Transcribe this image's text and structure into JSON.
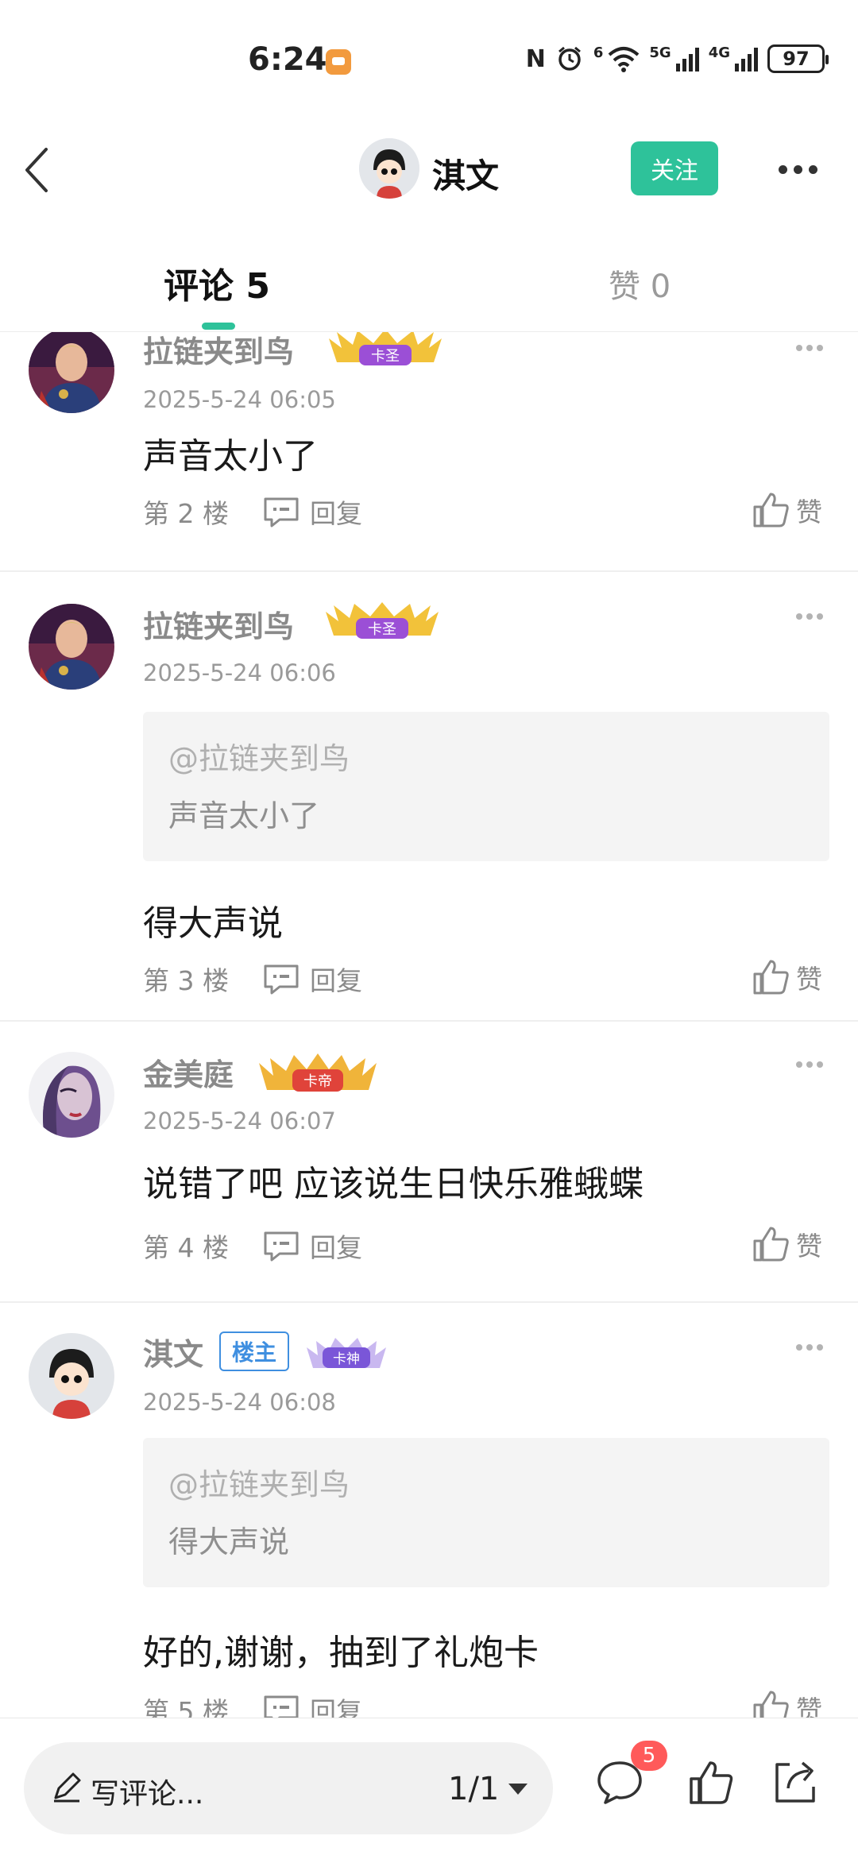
{
  "status_bar": {
    "time": "6:24",
    "net_5g": "5G",
    "net_4g": "4G",
    "wifi_label": "6",
    "battery": "97"
  },
  "header": {
    "title": "淇文",
    "follow_label": "关注"
  },
  "tabs": {
    "comments": "评论 5",
    "likes": "赞 0"
  },
  "comments": [
    {
      "author": "拉链夹到鸟",
      "badge": "卡圣",
      "time": "2025-5-24 06:05",
      "text": "声音太小了",
      "floor": "第 2 楼",
      "reply_label": "回复",
      "like_label": "赞"
    },
    {
      "author": "拉链夹到鸟",
      "badge": "卡圣",
      "time": "2025-5-24 06:06",
      "quote_user": "@拉链夹到鸟",
      "quote_text": "声音太小了",
      "text": "得大声说",
      "floor": "第 3 楼",
      "reply_label": "回复",
      "like_label": "赞"
    },
    {
      "author": "金美庭",
      "badge": "卡帝",
      "time": "2025-5-24 06:07",
      "text": "说错了吧 应该说生日快乐雅蛾蝶",
      "floor": "第 4 楼",
      "reply_label": "回复",
      "like_label": "赞"
    },
    {
      "author": "淇文",
      "owner_tag": "楼主",
      "badge": "卡神",
      "time": "2025-5-24 06:08",
      "quote_user": "@拉链夹到鸟",
      "quote_text": "得大声说",
      "text": "好的,谢谢，抽到了礼炮卡",
      "floor": "第 5 楼",
      "reply_label": "回复",
      "like_label": "赞"
    }
  ],
  "bottom_bar": {
    "compose_placeholder": "写评论...",
    "page_indicator": "1/1",
    "comment_count": "5"
  },
  "colors": {
    "accent": "#2ec29a",
    "owner_tag": "#3f8fe0",
    "badge_red": "#ff5a5a"
  }
}
